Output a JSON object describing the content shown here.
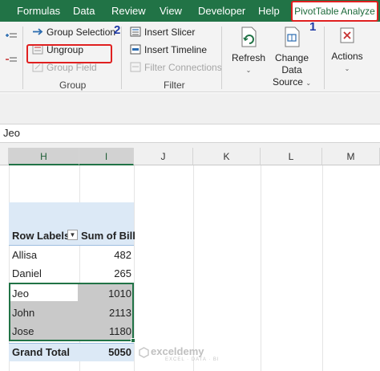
{
  "tabs": [
    "Formulas",
    "Data",
    "Review",
    "View",
    "Developer",
    "Help"
  ],
  "active_tab": "PivotTable Analyze",
  "annotations": {
    "one": "1",
    "two": "2"
  },
  "ribbon": {
    "group": {
      "group_selection": "Group Selection",
      "ungroup": "Ungroup",
      "group_field": "Group Field",
      "label": "Group"
    },
    "filter": {
      "insert_slicer": "Insert Slicer",
      "insert_timeline": "Insert Timeline",
      "filter_connections": "Filter Connections",
      "label": "Filter"
    },
    "data": {
      "refresh": "Refresh",
      "change_data_source_line1": "Change Data",
      "change_data_source_line2": "Source"
    },
    "actions": "Actions"
  },
  "formula_bar": {
    "value": "Jeo"
  },
  "columns": [
    "H",
    "I",
    "J",
    "K",
    "L",
    "M"
  ],
  "pivot": {
    "header_label": "Row Labels",
    "header_value": "Sum of Bill",
    "rows": [
      {
        "label": "Allisa",
        "value": "482"
      },
      {
        "label": "Daniel",
        "value": "265"
      },
      {
        "label": "Jeo",
        "value": "1010"
      },
      {
        "label": "John",
        "value": "2113"
      },
      {
        "label": "Jose",
        "value": "1180"
      }
    ],
    "grand_label": "Grand Total",
    "grand_value": "5050"
  },
  "watermark": {
    "name": "exceldemy",
    "tagline": "EXCEL · DATA · BI"
  },
  "colors": {
    "excel_green": "#217346",
    "annotation_red": "#e02020",
    "annotation_blue": "#1f3aa6",
    "pivot_blue": "#dce9f6"
  }
}
